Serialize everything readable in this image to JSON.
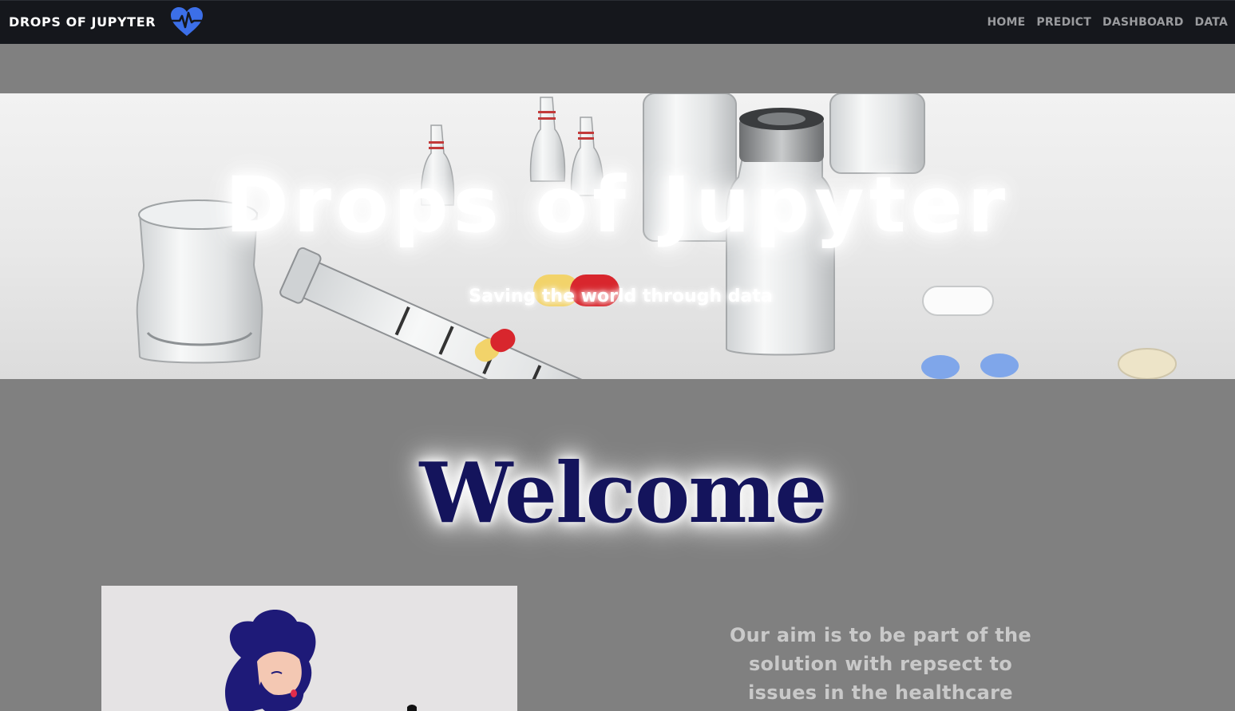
{
  "navbar": {
    "brand": "DROPS OF JUPYTER",
    "brand_icon": "heartbeat-icon",
    "links": [
      "HOME",
      "PREDICT",
      "DASHBOARD",
      "DATA"
    ]
  },
  "hero": {
    "title": "Drops of Jupyter",
    "subtitle": "Saving the world through data",
    "image": "medical-vials-syringe-pills-photo"
  },
  "welcome": {
    "heading": "Welcome"
  },
  "about": {
    "illustration": "bearded-person-illustration",
    "text": "Our aim is to be part of the solution with repsect to issues in the healthcare"
  },
  "colors": {
    "navbar_bg": "#15171c",
    "page_bg": "#808080",
    "brand_icon": "#3c6fe8",
    "welcome_text": "#14145c"
  }
}
